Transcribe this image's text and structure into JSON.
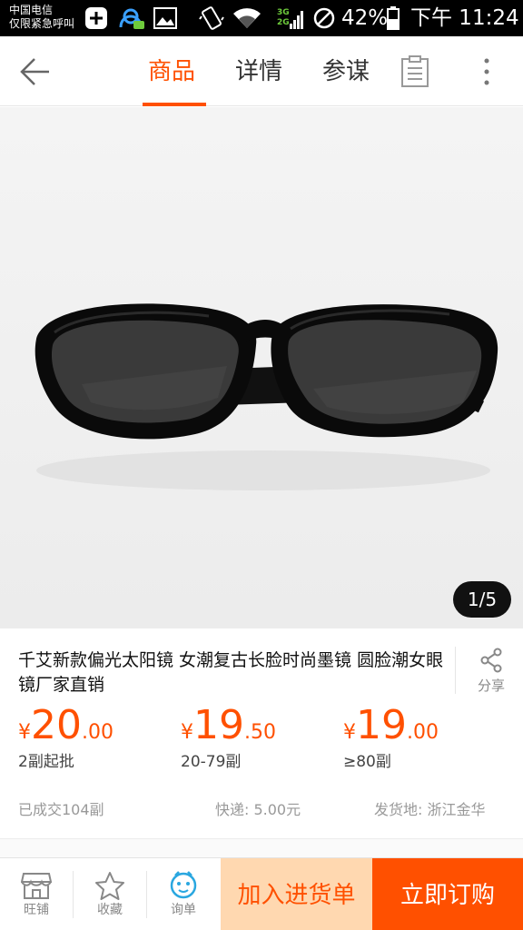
{
  "status_bar": {
    "carrier_line1": "中国电信",
    "carrier_line2": "仅限紧急呼叫",
    "network_label_top": "3G",
    "network_label_bottom": "2G",
    "battery_percent": "42%",
    "time": "下午 11:24"
  },
  "nav": {
    "tabs": [
      {
        "label": "商品",
        "active": true
      },
      {
        "label": "详情",
        "active": false
      },
      {
        "label": "参谋",
        "active": false
      }
    ],
    "accent_color": "#ff5000"
  },
  "gallery": {
    "pager": "1/5",
    "current_index": 1,
    "total": 5
  },
  "product": {
    "title": "千艾新款偏光太阳镜 女潮复古长脸时尚墨镜 圆脸潮女眼镜厂家直销",
    "share_label": "分享",
    "price_tiers": [
      {
        "currency": "¥",
        "integer": "20",
        "decimal": ".00",
        "quantity": "2副起批"
      },
      {
        "currency": "¥",
        "integer": "19",
        "decimal": ".50",
        "quantity": "20-79副"
      },
      {
        "currency": "¥",
        "integer": "19",
        "decimal": ".00",
        "quantity": "≥80副"
      }
    ],
    "sold": "已成交104副",
    "shipping": "快递: 5.00元",
    "origin": "发货地: 浙江金华"
  },
  "bottom_bar": {
    "shop_label": "旺铺",
    "favorite_label": "收藏",
    "inquiry_label": "询单",
    "add_to_cart_label": "加入进货单",
    "buy_now_label": "立即订购",
    "cart_bg": "#ffd8b0",
    "buy_bg": "#ff5000"
  }
}
